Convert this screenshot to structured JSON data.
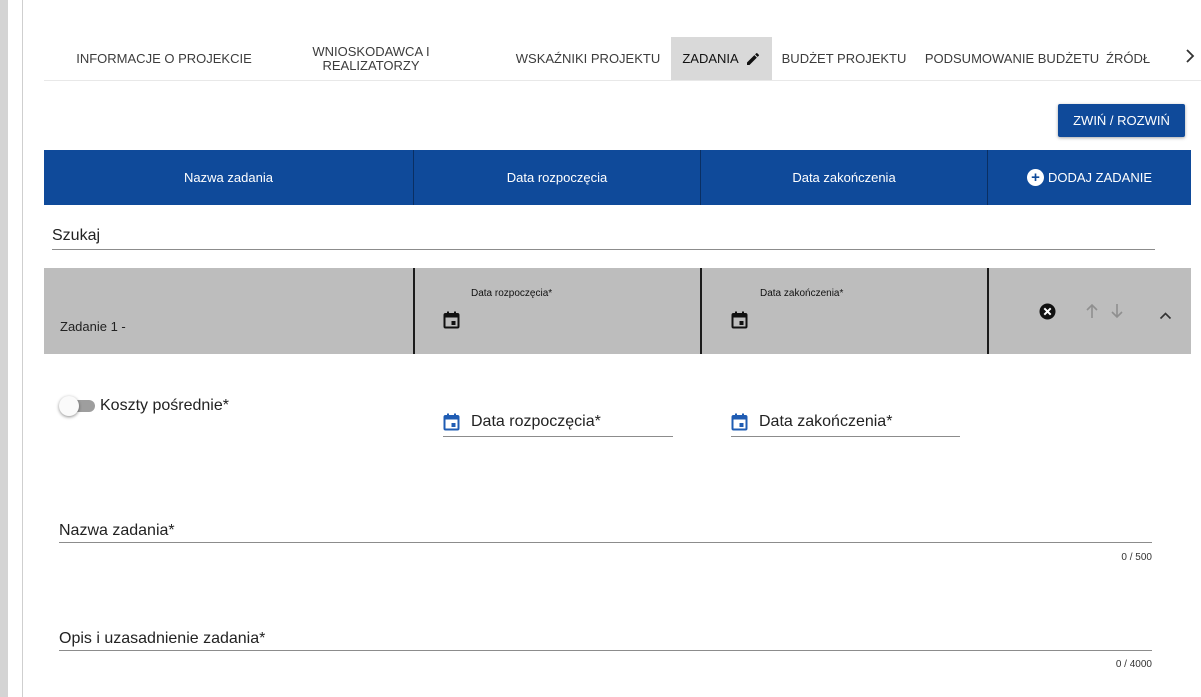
{
  "tabs": [
    {
      "label": "INFORMACJE O PROJEKCIE"
    },
    {
      "line1": "WNIOSKODAWCA I",
      "line2": "REALIZATORZY"
    },
    {
      "label": "WSKAŹNIKI PROJEKTU"
    },
    {
      "label": "ZADANIA"
    },
    {
      "label": "BUDŻET PROJEKTU"
    },
    {
      "label": "PODSUMOWANIE BUDŻETU"
    },
    {
      "label": "ŹRÓDŁ"
    }
  ],
  "toolbar": {
    "toggle_label": "ZWIŃ / ROZWIŃ"
  },
  "table_header": {
    "name": "Nazwa zadania",
    "start": "Data rozpoczęcia",
    "end": "Data zakończenia",
    "add": "DODAJ ZADANIE"
  },
  "search": {
    "placeholder": "Szukaj"
  },
  "task": {
    "title": "Zadanie 1 -",
    "start_label": "Data rozpoczęcia*",
    "end_label": "Data zakończenia*"
  },
  "form": {
    "indirect_costs_label": "Koszty pośrednie*",
    "start_label": "Data rozpoczęcia*",
    "end_label": "Data zakończenia*",
    "name_label": "Nazwa zadania*",
    "name_counter": "0 / 500",
    "description_label": "Opis i uzasadnienie zadania*",
    "description_counter": "0 / 4000"
  },
  "colors": {
    "primary": "#0f4a9a",
    "row_bg": "#bdbdbd",
    "active_tab": "#d9d9d9",
    "calendar_blue": "#1f5cb3"
  },
  "icons": [
    "pencil-icon",
    "chevron-right-icon",
    "plus-circle-icon",
    "calendar-icon",
    "close-circle-icon",
    "arrow-up-icon",
    "arrow-down-icon",
    "chevron-up-icon"
  ]
}
